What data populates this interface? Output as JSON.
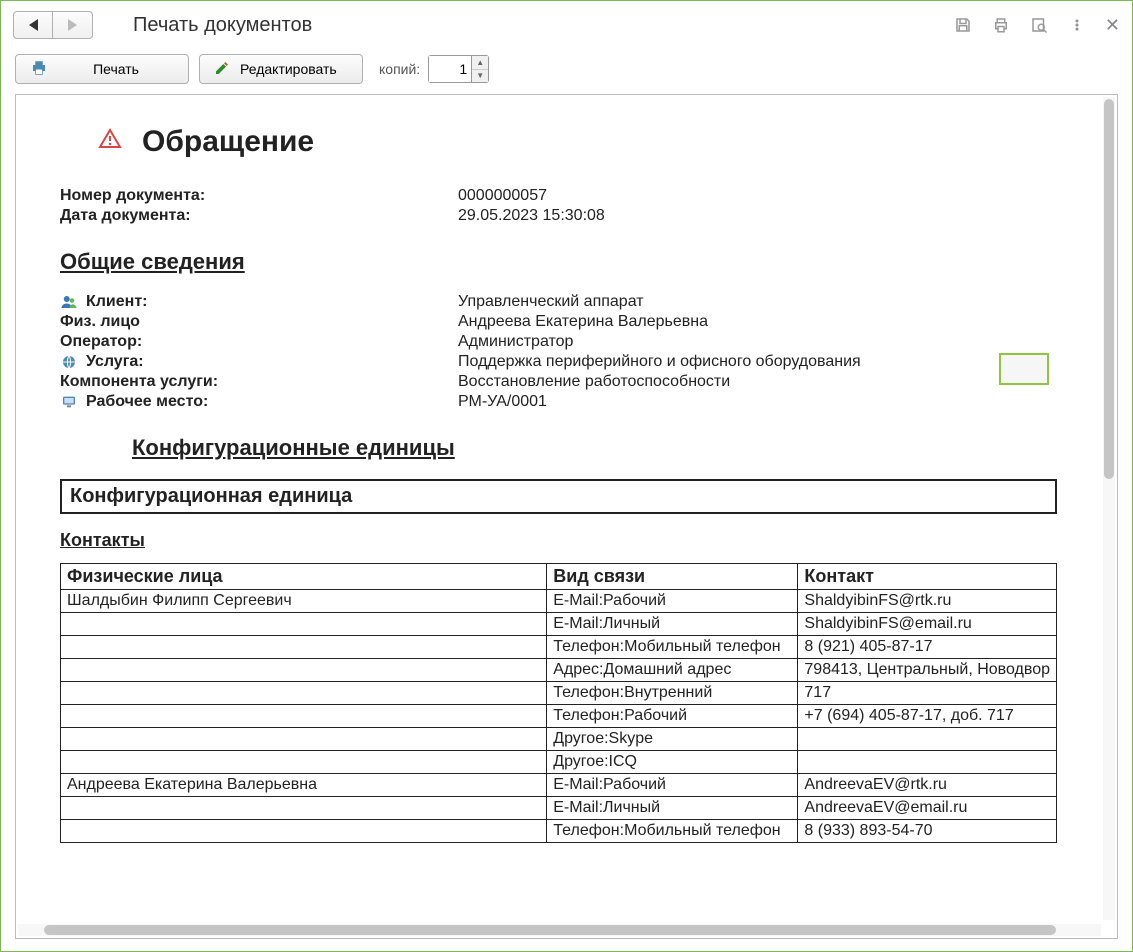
{
  "window": {
    "title": "Печать документов"
  },
  "toolbar": {
    "print_label": "Печать",
    "edit_label": "Редактировать",
    "copies_label": "копий:",
    "copies_value": "1"
  },
  "doc": {
    "title": "Обращение",
    "header_fields": {
      "doc_num_label": "Номер документа:",
      "doc_num_value": "0000000057",
      "doc_date_label": "Дата документа:",
      "doc_date_value": "29.05.2023 15:30:08"
    },
    "sections": {
      "general": "Общие сведения",
      "config_units": "Конфигурационные единицы",
      "config_unit_box": "Конфигурационная единица",
      "contacts": "Контакты"
    },
    "general": {
      "client_label": "Клиент:",
      "client_value": "Управленческий аппарат",
      "person_label": "Физ. лицо",
      "person_value": "Андреева Екатерина Валерьевна",
      "operator_label": "Оператор:",
      "operator_value": "Администратор",
      "service_label": "Услуга:",
      "service_value": "Поддержка периферийного и офисного оборудования",
      "component_label": "Компонента услуги:",
      "component_value": "Восстановление работоспособности",
      "workplace_label": "Рабочее место:",
      "workplace_value": "РМ-УА/0001"
    },
    "contacts_headers": {
      "people": "Физические лица",
      "type": "Вид связи",
      "contact": "Контакт"
    },
    "contacts_rows": [
      {
        "person": "Шалдыбин Филипп Сергеевич",
        "type": "E-Mail:Рабочий",
        "value": "ShaldyibinFS@rtk.ru"
      },
      {
        "person": "",
        "type": "E-Mail:Личный",
        "value": "ShaldyibinFS@email.ru"
      },
      {
        "person": "",
        "type": "Телефон:Мобильный телефон",
        "value": "8 (921) 405-87-17"
      },
      {
        "person": "",
        "type": "Адрес:Домашний адрес",
        "value": "798413, Центральный, Новодвор"
      },
      {
        "person": "",
        "type": "Телефон:Внутренний",
        "value": "717"
      },
      {
        "person": "",
        "type": "Телефон:Рабочий",
        "value": "+7 (694) 405-87-17, доб. 717"
      },
      {
        "person": "",
        "type": "Другое:Skype",
        "value": ""
      },
      {
        "person": "",
        "type": "Другое:ICQ",
        "value": ""
      },
      {
        "person": "Андреева Екатерина Валерьевна",
        "type": "E-Mail:Рабочий",
        "value": "AndreevaEV@rtk.ru"
      },
      {
        "person": "",
        "type": "E-Mail:Личный",
        "value": "AndreevaEV@email.ru"
      },
      {
        "person": "",
        "type": "Телефон:Мобильный телефон",
        "value": "8 (933) 893-54-70"
      }
    ]
  }
}
